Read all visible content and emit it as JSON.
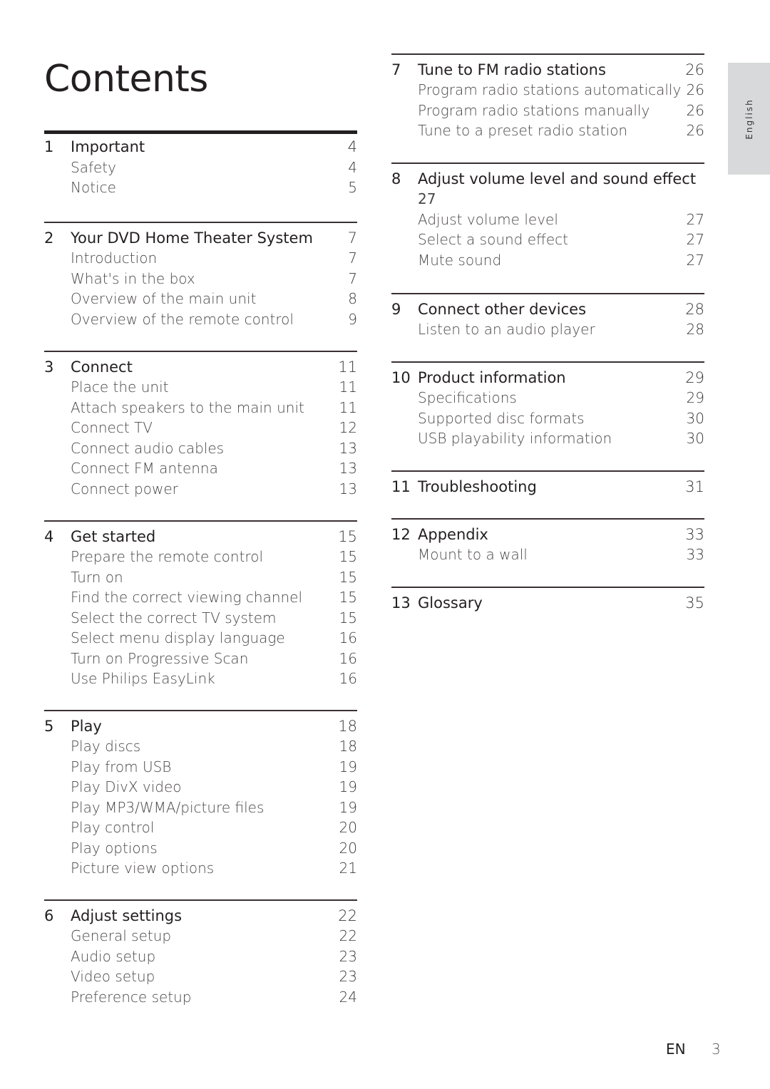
{
  "page": {
    "title": "Contents",
    "language_tab": "English",
    "footer": {
      "lang": "EN",
      "page_number": "3"
    }
  },
  "sections": [
    {
      "num": "1",
      "title": "Important",
      "page": "4",
      "items": [
        {
          "label": "Safety",
          "page": "4"
        },
        {
          "label": "Notice",
          "page": "5"
        }
      ]
    },
    {
      "num": "2",
      "title": "Your DVD Home Theater System",
      "page": "7",
      "items": [
        {
          "label": "Introduction",
          "page": "7"
        },
        {
          "label": "What's in the box",
          "page": "7"
        },
        {
          "label": "Overview of the main unit",
          "page": "8"
        },
        {
          "label": "Overview of the remote control",
          "page": "9"
        }
      ]
    },
    {
      "num": "3",
      "title": "Connect",
      "page": "11",
      "items": [
        {
          "label": "Place the unit",
          "page": "11"
        },
        {
          "label": "Attach speakers to the main unit",
          "page": "11"
        },
        {
          "label": "Connect TV",
          "page": "12"
        },
        {
          "label": "Connect audio cables",
          "page": "13"
        },
        {
          "label": "Connect FM antenna",
          "page": "13"
        },
        {
          "label": "Connect power",
          "page": "13"
        }
      ]
    },
    {
      "num": "4",
      "title": "Get started",
      "page": "15",
      "items": [
        {
          "label": "Prepare the remote control",
          "page": "15"
        },
        {
          "label": "Turn on",
          "page": "15"
        },
        {
          "label": "Find the correct viewing channel",
          "page": "15"
        },
        {
          "label": "Select the correct TV system",
          "page": "15"
        },
        {
          "label": "Select menu display language",
          "page": "16"
        },
        {
          "label": "Turn on Progressive Scan",
          "page": "16"
        },
        {
          "label": "Use Philips EasyLink",
          "page": "16"
        }
      ]
    },
    {
      "num": "5",
      "title": "Play",
      "page": "18",
      "items": [
        {
          "label": "Play discs",
          "page": "18"
        },
        {
          "label": "Play from USB",
          "page": "19"
        },
        {
          "label": "Play DivX video",
          "page": "19"
        },
        {
          "label": "Play MP3/WMA/picture files",
          "page": "19"
        },
        {
          "label": "Play control",
          "page": "20"
        },
        {
          "label": "Play options",
          "page": "20"
        },
        {
          "label": "Picture view options",
          "page": "21"
        }
      ]
    },
    {
      "num": "6",
      "title": "Adjust settings",
      "page": "22",
      "items": [
        {
          "label": "General setup",
          "page": "22"
        },
        {
          "label": "Audio setup",
          "page": "23"
        },
        {
          "label": "Video setup",
          "page": "23"
        },
        {
          "label": "Preference setup",
          "page": "24"
        }
      ]
    },
    {
      "num": "7",
      "title": "Tune to FM radio stations",
      "page": "26",
      "items": [
        {
          "label": "Program radio stations automatically",
          "page": "26"
        },
        {
          "label": "Program radio stations manually",
          "page": "26"
        },
        {
          "label": "Tune to a preset radio station",
          "page": "26"
        }
      ]
    },
    {
      "num": "8",
      "title": "Adjust volume level and sound effect",
      "page": "27",
      "items": [
        {
          "label": "Adjust volume level",
          "page": "27"
        },
        {
          "label": "Select a sound effect",
          "page": "27"
        },
        {
          "label": "Mute sound",
          "page": "27"
        }
      ]
    },
    {
      "num": "9",
      "title": "Connect other devices",
      "page": "28",
      "items": [
        {
          "label": "Listen to an audio player",
          "page": "28"
        }
      ]
    },
    {
      "num": "10",
      "title": "Product information",
      "page": "29",
      "items": [
        {
          "label": "Specifications",
          "page": "29"
        },
        {
          "label": "Supported disc formats",
          "page": "30"
        },
        {
          "label": "USB playability information",
          "page": "30"
        }
      ]
    },
    {
      "num": "11",
      "title": "Troubleshooting",
      "page": "31",
      "items": []
    },
    {
      "num": "12",
      "title": "Appendix",
      "page": "33",
      "items": [
        {
          "label": "Mount to a wall",
          "page": "33"
        }
      ]
    },
    {
      "num": "13",
      "title": "Glossary",
      "page": "35",
      "items": []
    }
  ]
}
